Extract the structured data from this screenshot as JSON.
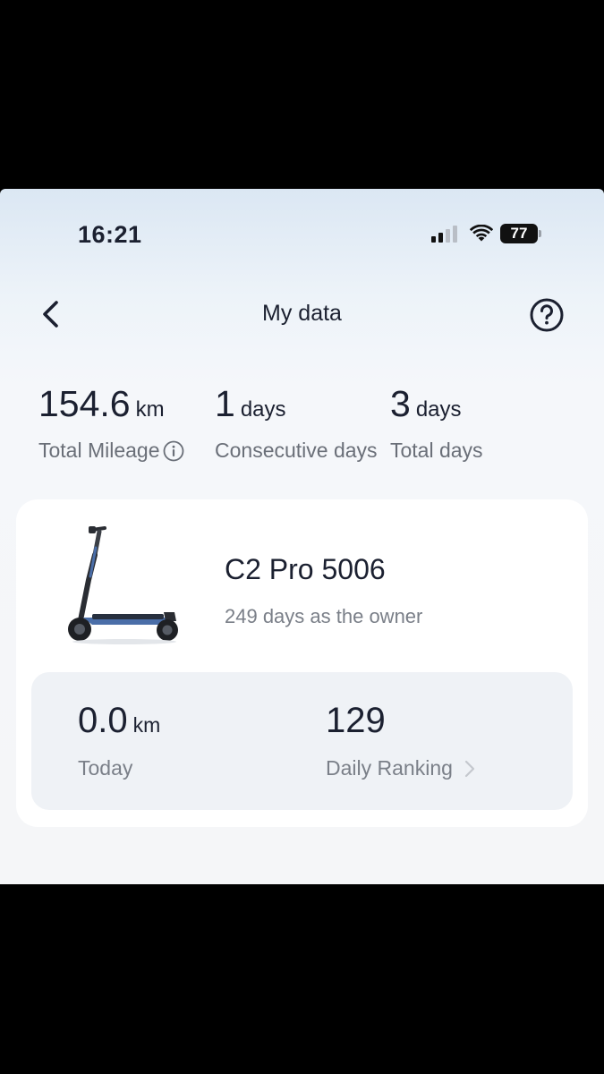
{
  "status_bar": {
    "time": "16:21",
    "battery": "77"
  },
  "header": {
    "title": "My data"
  },
  "stats": {
    "total_mileage": {
      "value": "154.6",
      "unit": "km",
      "label": "Total Mileage"
    },
    "consecutive_days": {
      "value": "1",
      "unit": "days",
      "label": "Consecutive days"
    },
    "total_days": {
      "value": "3",
      "unit": "days",
      "label": "Total days"
    }
  },
  "device": {
    "name": "C2 Pro 5006",
    "owner_text": "249 days as the owner",
    "today": {
      "value": "0.0",
      "unit": "km",
      "label": "Today"
    },
    "ranking": {
      "value": "129",
      "label": "Daily Ranking"
    }
  },
  "icons": {
    "back": "chevron-left-icon",
    "help": "question-circle-icon",
    "info": "info-circle-icon",
    "ranking_arrow": "chevron-right-icon"
  },
  "colors": {
    "text_primary": "#1b2030",
    "text_secondary": "#6a6f78",
    "scooter_accent": "#4a6ea8"
  }
}
